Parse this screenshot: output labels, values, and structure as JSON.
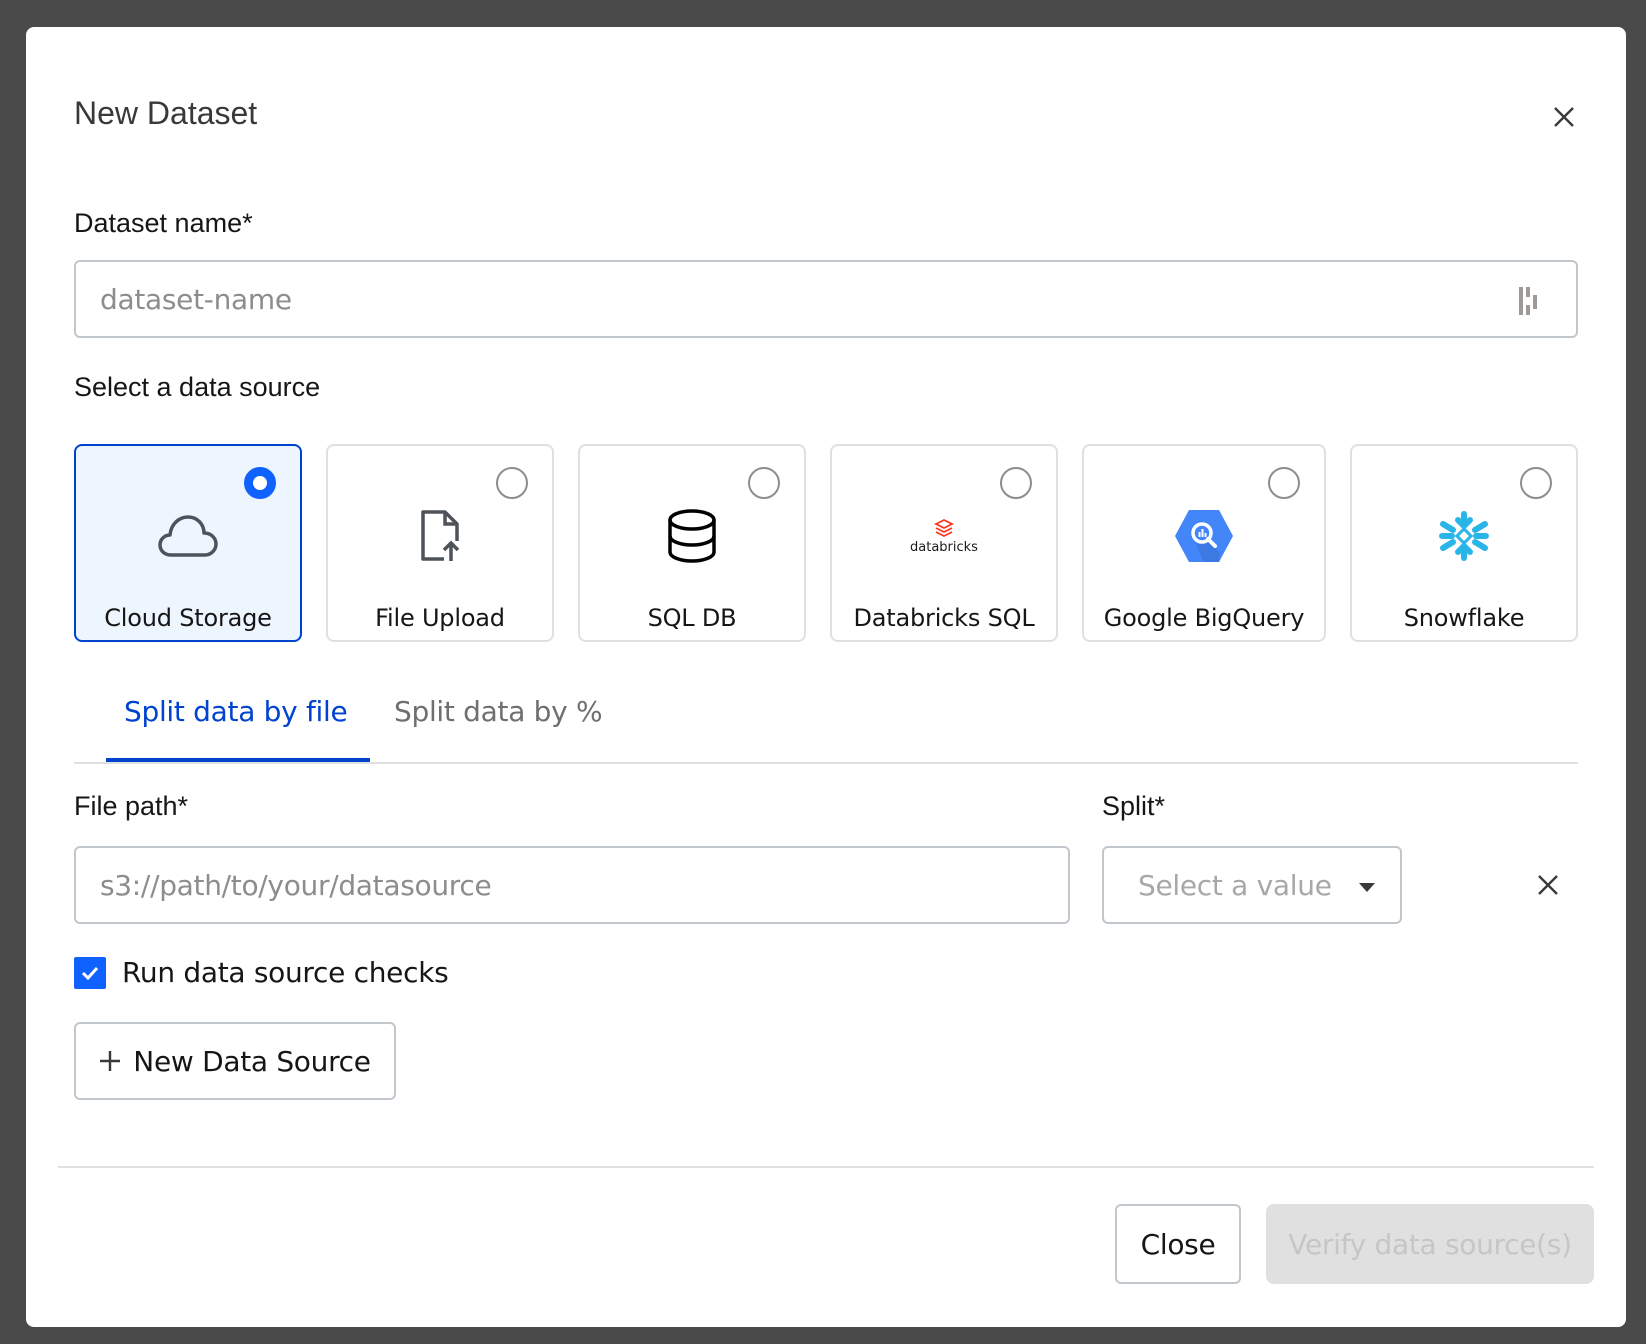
{
  "dialog": {
    "title": "New Dataset",
    "close_icon": "close-icon"
  },
  "dataset_name": {
    "label": "Dataset name*",
    "placeholder": "dataset-name",
    "value": "",
    "autofill_icon": "password-manager-icon"
  },
  "data_source": {
    "label": "Select a data source",
    "selected": "Cloud Storage",
    "options": [
      {
        "label": "Cloud Storage",
        "icon": "cloud-icon",
        "selected": true
      },
      {
        "label": "File Upload",
        "icon": "file-upload-icon",
        "selected": false
      },
      {
        "label": "SQL DB",
        "icon": "database-icon",
        "selected": false
      },
      {
        "label": "Databricks SQL",
        "icon": "databricks-logo",
        "logo_text": "databricks",
        "selected": false
      },
      {
        "label": "Google BigQuery",
        "icon": "bigquery-logo",
        "selected": false
      },
      {
        "label": "Snowflake",
        "icon": "snowflake-logo",
        "selected": false
      }
    ]
  },
  "tabs": [
    {
      "label": "Split data by file",
      "active": true
    },
    {
      "label": "Split data by %",
      "active": false
    }
  ],
  "file_row": {
    "file_path_label": "File path*",
    "file_path_placeholder": "s3://path/to/your/datasource",
    "file_path_value": "",
    "split_label": "Split*",
    "split_placeholder": "Select a value",
    "remove_icon": "close-icon"
  },
  "checks": {
    "label": "Run data source checks",
    "checked": true
  },
  "new_source_button": {
    "label": "New Data Source",
    "icon": "plus-icon"
  },
  "footer": {
    "close_label": "Close",
    "verify_label": "Verify data source(s)",
    "verify_disabled": true
  },
  "colors": {
    "accent": "#0f62fe",
    "accent_dark": "#0043ce",
    "selected_card_bg": "#edf5ff",
    "databricks": "#ff3621",
    "bigquery": "#4386fa",
    "snowflake": "#29b5e8"
  }
}
